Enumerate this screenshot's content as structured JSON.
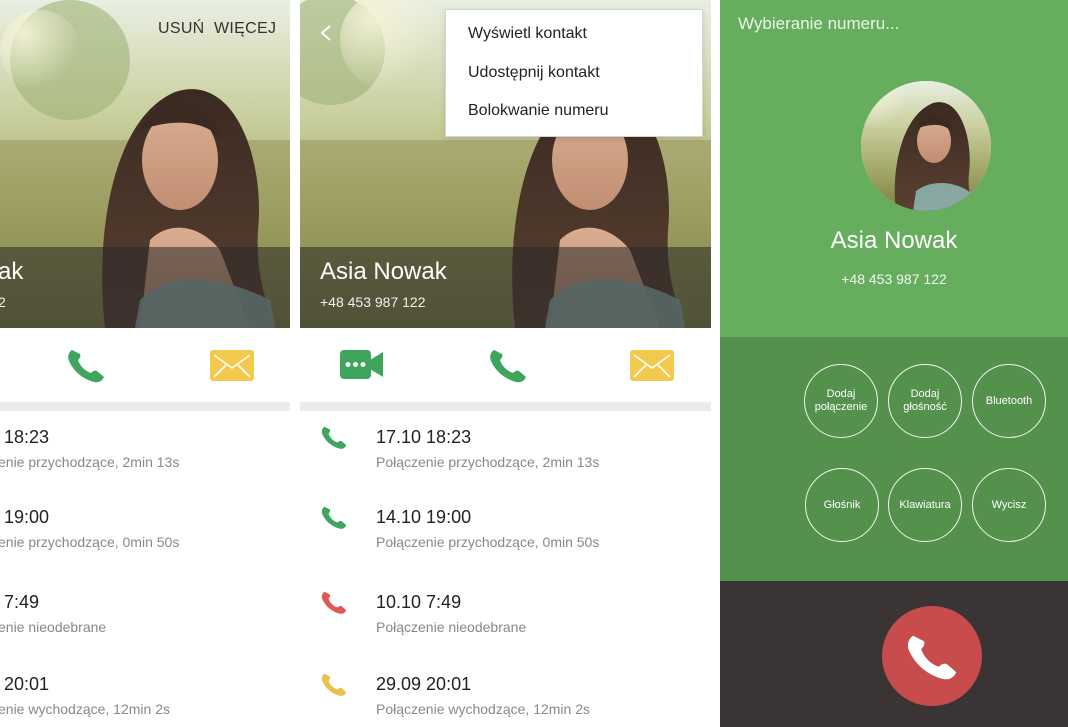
{
  "colors": {
    "call_green": "#3fa45c",
    "missed_red": "#e05a55",
    "outgoing_yellow": "#e8c34a",
    "mail_yellow": "#f2c94c",
    "dial_green": "#66ad5e",
    "dial_controls_green": "#54914d",
    "end_red": "#c94c4c",
    "end_bg": "#3a3534"
  },
  "left_panel": {
    "actions": {
      "delete": "USUŃ",
      "more": "WIĘCEJ"
    },
    "contact": {
      "name": "Asia Nowak",
      "number": "+48 453 987 122"
    },
    "icons": [
      "phone-icon",
      "mail-icon"
    ]
  },
  "middle_panel": {
    "contact": {
      "name": "Asia Nowak",
      "number": "+48 453 987 122"
    },
    "back_icon": "back-chevron-icon",
    "menu": {
      "items": [
        "Wyświetl kontakt",
        "Udostępnij kontakt",
        "Bolokwanie numeru"
      ]
    },
    "icons": [
      "video-call-icon",
      "phone-icon",
      "mail-icon"
    ]
  },
  "call_log": [
    {
      "date": "17.10 18:23",
      "desc": "Połączenie przychodzące, 2min 13s",
      "type": "incoming",
      "icon": "incoming-call-icon"
    },
    {
      "date": "14.10 19:00",
      "desc": "Połączenie przychodzące, 0min 50s",
      "type": "incoming",
      "icon": "incoming-call-icon"
    },
    {
      "date": "10.10 7:49",
      "desc": "Połączenie nieodebrane",
      "type": "missed",
      "icon": "missed-call-icon"
    },
    {
      "date": "29.09 20:01",
      "desc": "Połączenie wychodzące, 12min 2s",
      "type": "outgoing",
      "icon": "outgoing-call-icon"
    }
  ],
  "call_log_left_cropped": [
    {
      "date": "18:23",
      "desc": "enie przychodzące, 2min 13s"
    },
    {
      "date": "19:00",
      "desc": "enie przychodzące, 0min 50s"
    },
    {
      "date": "7:49",
      "desc": "enie nieodebrane"
    },
    {
      "date": "20:01",
      "desc": "enie wychodzące, 12min 2s"
    }
  ],
  "left_contact_cropped": {
    "name": "ak",
    "number": "2"
  },
  "dial_screen": {
    "title": "Wybieranie numeru...",
    "name": "Asia Nowak",
    "number": "+48 453 987 122",
    "controls": [
      {
        "label": "Dodaj połączenie",
        "line1": "Dodaj",
        "line2": "połączenie"
      },
      {
        "label": "Dodaj głośność",
        "line1": "Dodaj",
        "line2": "głośność"
      },
      {
        "label": "Bluetooth",
        "line1": "Bluetooth",
        "line2": ""
      },
      {
        "label": "Głośnik",
        "line1": "Głośnik",
        "line2": ""
      },
      {
        "label": "Klawiatura",
        "line1": "Klawiatura",
        "line2": ""
      },
      {
        "label": "Wycisz",
        "line1": "Wycisz",
        "line2": ""
      }
    ],
    "end_icon": "end-call-icon"
  }
}
